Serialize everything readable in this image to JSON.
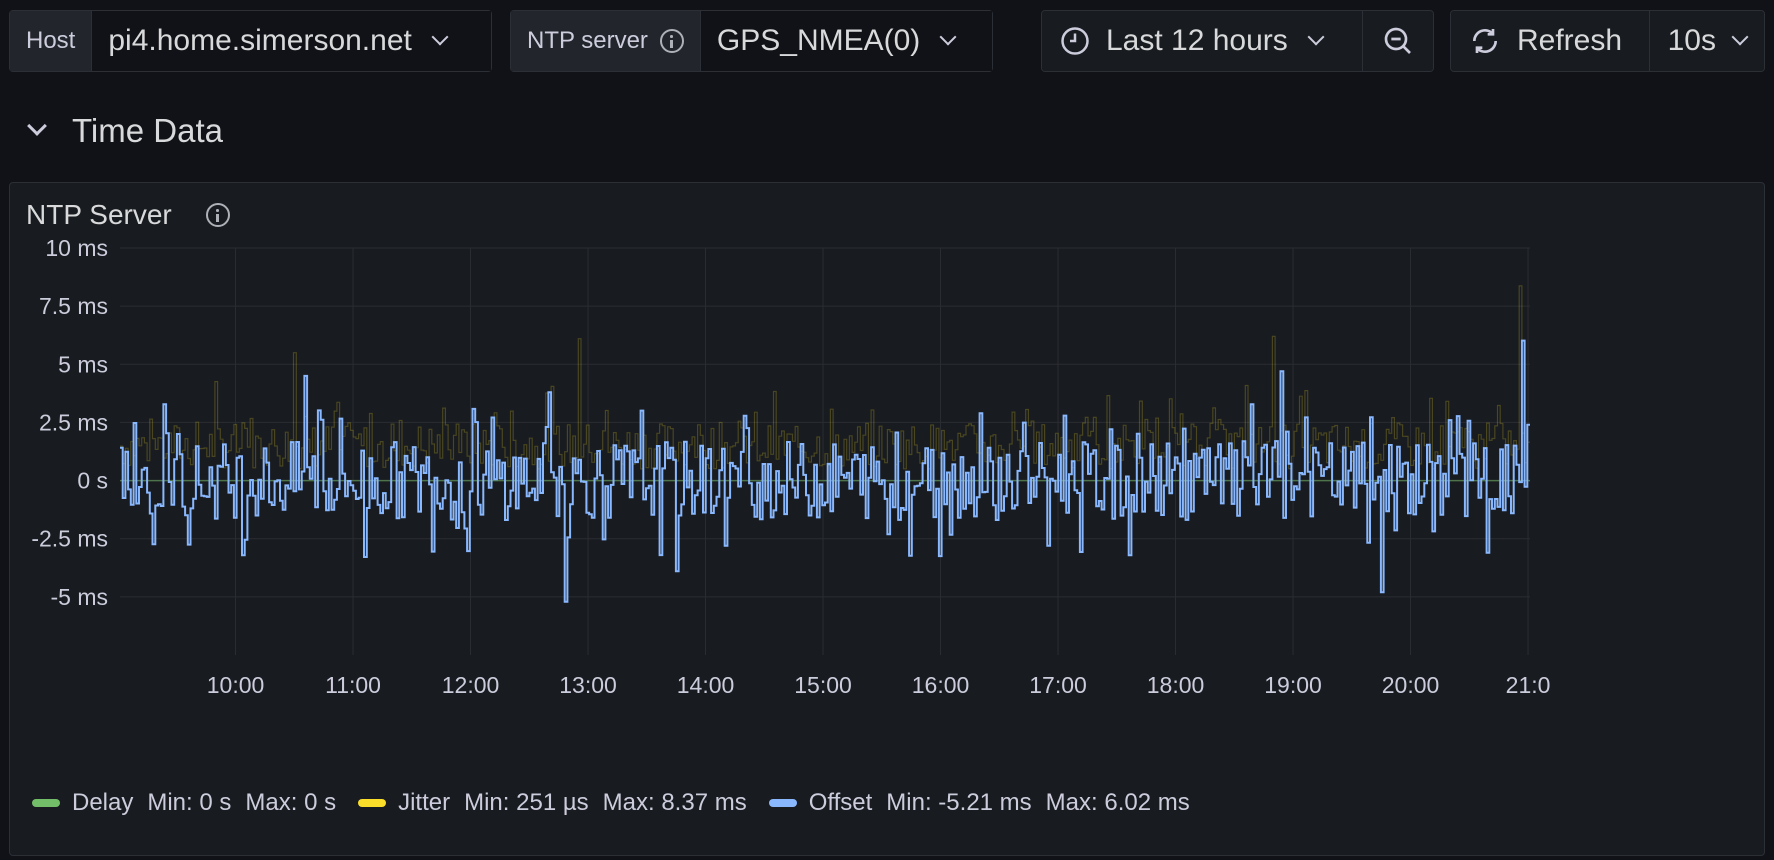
{
  "variables": {
    "host_label": "Host",
    "host_value": "pi4.home.simerson.net",
    "ntp_label": "NTP server",
    "ntp_value": "GPS_NMEA(0)"
  },
  "toolbar": {
    "time_range": "Last 12 hours",
    "refresh_label": "Refresh",
    "refresh_interval": "10s"
  },
  "row": {
    "title": "Time Data"
  },
  "panel": {
    "title": "NTP Server"
  },
  "legend": [
    {
      "name": "Delay",
      "color": "#73bf69",
      "min": "Min: 0 s",
      "max": "Max: 0 s"
    },
    {
      "name": "Jitter",
      "color": "#fade2a",
      "min": "Min: 251 µs",
      "max": "Max: 8.37 ms"
    },
    {
      "name": "Offset",
      "color": "#8ab8ff",
      "min": "Min: -5.21 ms",
      "max": "Max: 6.02 ms"
    }
  ],
  "chart_data": {
    "type": "line",
    "xlabel": "",
    "ylabel": "",
    "x_range": [
      "09:01",
      "21:01"
    ],
    "x_ticks": [
      "10:00",
      "11:00",
      "12:00",
      "13:00",
      "14:00",
      "15:00",
      "16:00",
      "17:00",
      "18:00",
      "19:00",
      "20:00",
      "21:0"
    ],
    "y_ticks": [
      "10 ms",
      "7.5 ms",
      "5 ms",
      "2.5 ms",
      "0 s",
      "-2.5 ms",
      "-5 ms"
    ],
    "ylim": [
      -7.5,
      10
    ],
    "grid": true,
    "legend_position": "bottom-left",
    "series": [
      {
        "name": "Delay",
        "color": "#73bf69",
        "summary": {
          "min_ms": 0,
          "max_ms": 0
        }
      },
      {
        "name": "Jitter",
        "color": "#fade2a",
        "summary": {
          "min_ms": 0.251,
          "max_ms": 8.37
        },
        "peaks": [
          {
            "x": "10:30",
            "y": 5.5
          },
          {
            "x": "12:55",
            "y": 6.1
          },
          {
            "x": "18:50",
            "y": 6.2
          },
          {
            "x": "20:56",
            "y": 8.37
          }
        ]
      },
      {
        "name": "Offset",
        "color": "#8ab8ff",
        "summary": {
          "min_ms": -5.21,
          "max_ms": 6.02
        },
        "peaks": [
          {
            "x": "10:35",
            "y": 4.5
          },
          {
            "x": "12:40",
            "y": 3.8
          },
          {
            "x": "12:48",
            "y": -5.21
          },
          {
            "x": "13:45",
            "y": -3.9
          },
          {
            "x": "18:53",
            "y": 4.7
          },
          {
            "x": "19:45",
            "y": -4.8
          },
          {
            "x": "20:57",
            "y": 6.02
          }
        ]
      }
    ]
  }
}
